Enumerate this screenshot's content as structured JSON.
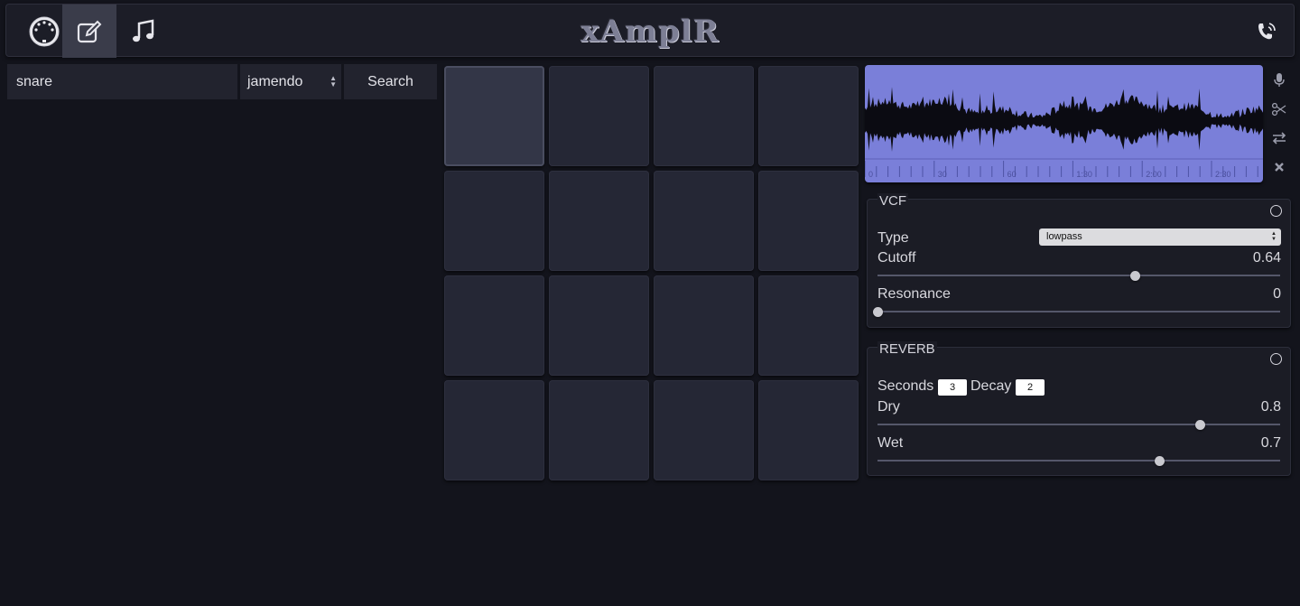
{
  "header": {
    "app_title": "xAmplR",
    "buttons": [
      {
        "icon": "midi-icon",
        "active": false
      },
      {
        "icon": "edit-icon",
        "active": true
      },
      {
        "icon": "music-note-icon",
        "active": false
      }
    ],
    "right_icon": "phone-icon"
  },
  "search": {
    "query": "snare",
    "source_selected": "jamendo",
    "button_label": "Search"
  },
  "pads": {
    "rows": 4,
    "cols": 4,
    "selected_index": 0
  },
  "waveform": {
    "color": "#7a7fd9",
    "time_labels": [
      "0",
      "30",
      "60",
      "1:30",
      "2:00",
      "2:30"
    ],
    "tools": [
      "microphone-icon",
      "scissors-icon",
      "swap-arrows-icon",
      "close-icon"
    ]
  },
  "vcf": {
    "title": "VCF",
    "type_label": "Type",
    "type_value": "lowpass",
    "cutoff_label": "Cutoff",
    "cutoff_value": "0.64",
    "cutoff_fraction": 0.64,
    "resonance_label": "Resonance",
    "resonance_value": "0",
    "resonance_fraction": 0
  },
  "reverb": {
    "title": "REVERB",
    "seconds_label": "Seconds",
    "seconds_value": "3",
    "decay_label": "Decay",
    "decay_value": "2",
    "dry_label": "Dry",
    "dry_value": "0.8",
    "dry_fraction": 0.8,
    "wet_label": "Wet",
    "wet_value": "0.7",
    "wet_fraction": 0.7
  }
}
